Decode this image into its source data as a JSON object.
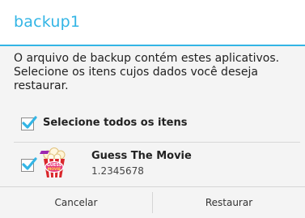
{
  "dialog": {
    "title": "backup1",
    "message": "O arquivo de backup contém estes aplicativos. Selecione os itens cujos dados você deseja restaurar.",
    "accent_color": "#33b5e5",
    "select_all": {
      "label": "Selecione todos os itens",
      "checked": true
    },
    "apps": [
      {
        "name": "Guess The Movie",
        "version": "1.2345678",
        "checked": true,
        "icon": "popcorn-movie-icon"
      }
    ],
    "buttons": {
      "cancel": "Cancelar",
      "restore": "Restaurar"
    }
  }
}
